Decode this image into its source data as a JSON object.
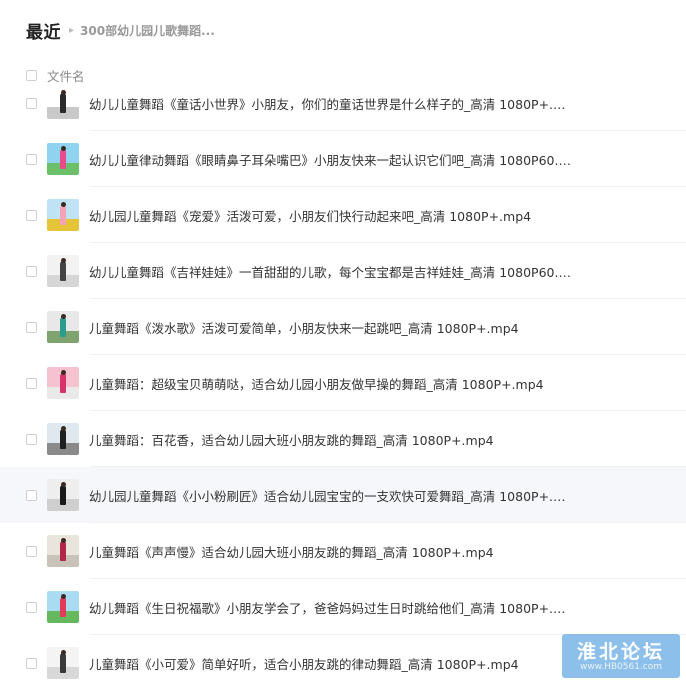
{
  "header": {
    "title": "最近",
    "separator": "▸",
    "breadcrumb": "300部幼儿园儿歌舞蹈..."
  },
  "list_header": {
    "column": "文件名"
  },
  "files": [
    {
      "name": "幼儿儿童舞蹈《童话小世界》小朋友，你们的童话世界是什么样子的_高清 1080P+.…",
      "colors": {
        "sky": "#ffffff",
        "ground": "#c9c9c9",
        "fig": "#2a2a2a"
      }
    },
    {
      "name": "幼儿儿童律动舞蹈《眼睛鼻子耳朵嘴巴》小朋友快来一起认识它们吧_高清 1080P60.…",
      "colors": {
        "sky": "#8fd3f0",
        "ground": "#6cc06a",
        "fig": "#e84a8a"
      }
    },
    {
      "name": "幼儿园儿童舞蹈《宠爱》活泼可爱，小朋友们快行动起来吧_高清 1080P+.mp4",
      "colors": {
        "sky": "#bfe3f5",
        "ground": "#e6c43a",
        "fig": "#f2a3b8"
      }
    },
    {
      "name": "幼儿儿童舞蹈《吉祥娃娃》一首甜甜的儿歌，每个宝宝都是吉祥娃娃_高清 1080P60.…",
      "colors": {
        "sky": "#f2f2f2",
        "ground": "#d6d6d6",
        "fig": "#444444"
      }
    },
    {
      "name": "儿童舞蹈《泼水歌》活泼可爱简单，小朋友快来一起跳吧_高清 1080P+.mp4",
      "colors": {
        "sky": "#e8e8e8",
        "ground": "#7fa36e",
        "fig": "#2c9c8f"
      }
    },
    {
      "name": "儿童舞蹈：超级宝贝萌萌哒，适合幼儿园小朋友做早操的舞蹈_高清 1080P+.mp4",
      "colors": {
        "sky": "#f7c2d0",
        "ground": "#e9e9e9",
        "fig": "#d6336c"
      }
    },
    {
      "name": "儿童舞蹈：百花香，适合幼儿园大班小朋友跳的舞蹈_高清 1080P+.mp4",
      "colors": {
        "sky": "#dfe7ef",
        "ground": "#8a8a8a",
        "fig": "#1f1f1f"
      }
    },
    {
      "name": "幼儿园儿童舞蹈《小小粉刷匠》适合幼儿园宝宝的一支欢快可爱舞蹈_高清 1080P+.…",
      "colors": {
        "sky": "#eeeeee",
        "ground": "#cfcfcf",
        "fig": "#1a1a1a"
      }
    },
    {
      "name": "儿童舞蹈《声声慢》适合幼儿园大班小朋友跳的舞蹈_高清 1080P+.mp4",
      "colors": {
        "sky": "#e9e4dc",
        "ground": "#c9c2b8",
        "fig": "#b0274a"
      }
    },
    {
      "name": "幼儿舞蹈《生日祝福歌》小朋友学会了，爸爸妈妈过生日时跳给他们_高清 1080P+.…",
      "colors": {
        "sky": "#a9dcf3",
        "ground": "#66b85e",
        "fig": "#e23b5a"
      }
    },
    {
      "name": "儿童舞蹈《小可爱》简单好听，适合小朋友跳的律动舞蹈_高清 1080P+.mp4",
      "colors": {
        "sky": "#f4f4f4",
        "ground": "#d8d8d8",
        "fig": "#3a3a3a"
      }
    }
  ],
  "highlighted_index": 7,
  "watermark": {
    "text": "淮北论坛",
    "url": "www.HB0561.com"
  }
}
